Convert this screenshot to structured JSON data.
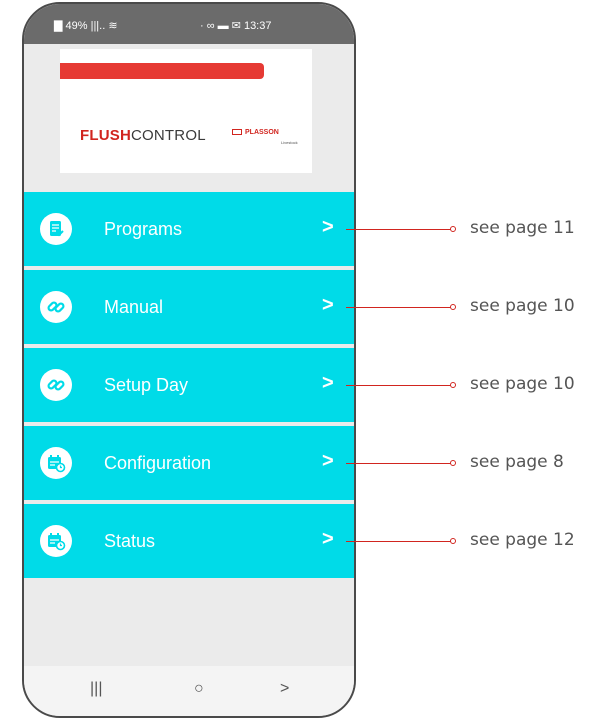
{
  "status_bar": {
    "left": "▇ 49% |||.. ≋",
    "right": "· ∞ ▬ ✉ 13:37"
  },
  "header": {
    "logo_bold": "FLUSH",
    "logo_rest": "CONTROL",
    "brand": "PLASSON",
    "brand_sub": "Livestock"
  },
  "menu": [
    {
      "label": "Programs",
      "icon": "document-check-icon",
      "chevron": ">"
    },
    {
      "label": "Manual",
      "icon": "link-icon",
      "chevron": ">"
    },
    {
      "label": "Setup Day",
      "icon": "link-icon",
      "chevron": ">"
    },
    {
      "label": "Configuration",
      "icon": "calendar-clock-icon",
      "chevron": ">"
    },
    {
      "label": "Status",
      "icon": "calendar-clock-icon",
      "chevron": ">"
    }
  ],
  "callouts": [
    "see page 11",
    "see page 10",
    "see page 10",
    "see page 8",
    "see page 12"
  ],
  "nav": {
    "recent": "|||",
    "home": "○",
    "back": ">"
  },
  "colors": {
    "menu_bg": "#00dbe8",
    "accent_red": "#e63a34",
    "callout": "#d1251f"
  }
}
